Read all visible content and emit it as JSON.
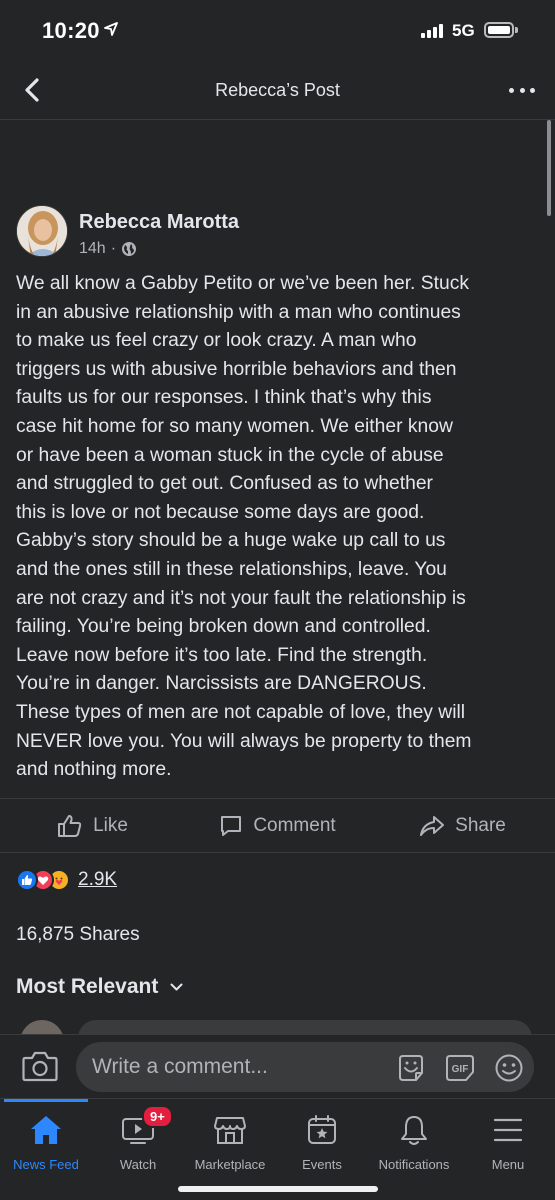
{
  "status": {
    "time": "10:20",
    "network": "5G"
  },
  "header": {
    "title": "Rebecca’s Post"
  },
  "post": {
    "author": "Rebecca Marotta",
    "time": "14h",
    "meta_sep": "·",
    "lines": [
      "We all know a Gabby Petito or we’ve been her. Stuck",
      "in an abusive relationship with a man who continues",
      "to make us feel crazy or look crazy. A man who",
      "triggers us with abusive horrible behaviors and then",
      "faults us for our responses. I think that’s why this",
      "case hit home for so many women. We either know",
      "or have been a woman stuck in the cycle of abuse",
      "and struggled to get out. Confused as to whether",
      "this is love or not because some days are good.",
      "Gabby’s story should be a huge wake up call to us",
      "and the ones still in these relationships, leave. You",
      "are not crazy and it’s not your fault the relationship is",
      "failing. You’re being broken down and controlled.",
      "Leave now before it’s too late. Find the strength.",
      "You’re in danger. Narcissists are DANGEROUS.",
      "These types of men are not capable of love, they will",
      "NEVER love you. You will always be property to them",
      "and nothing more."
    ]
  },
  "actions": {
    "like": "Like",
    "comment": "Comment",
    "share": "Share"
  },
  "reactions": {
    "count": "2.9K"
  },
  "shares": "16,875 Shares",
  "sort_label": "Most Relevant",
  "composer": {
    "placeholder": "Write a comment..."
  },
  "tabs": {
    "news_feed": "News Feed",
    "watch": "Watch",
    "watch_badge": "9+",
    "marketplace": "Marketplace",
    "events": "Events",
    "notifications": "Notifications",
    "menu": "Menu"
  },
  "colors": {
    "accent": "#2d88ff",
    "background": "#242526",
    "badge": "#e41e3f"
  }
}
